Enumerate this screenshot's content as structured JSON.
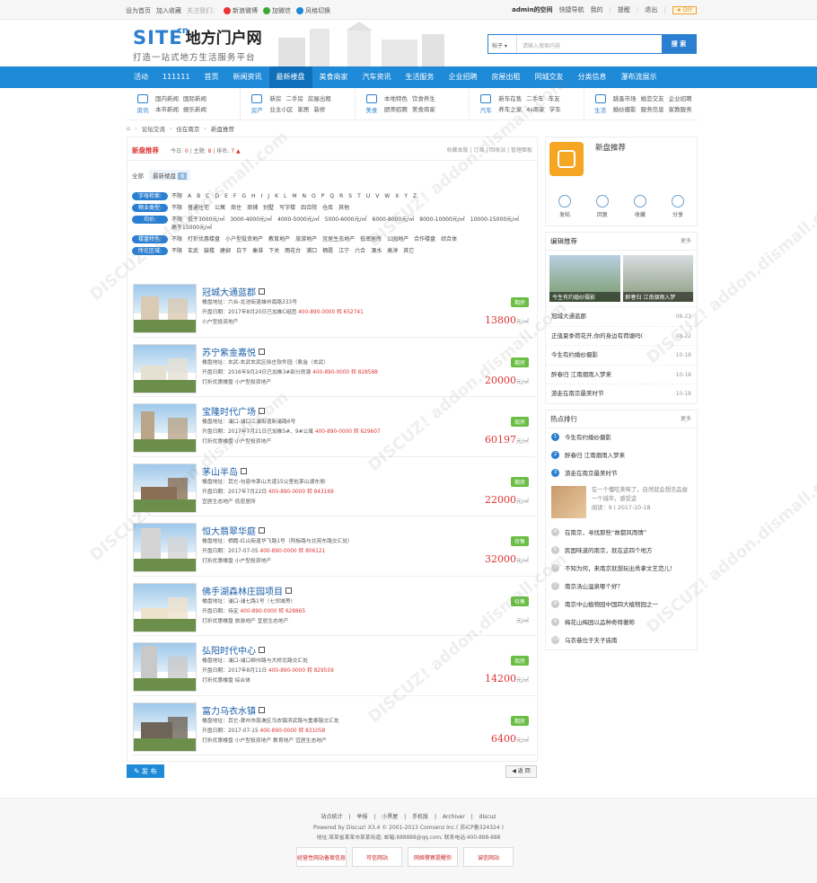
{
  "topbar": {
    "set_home": "设为首页",
    "add_fav": "加入收藏",
    "follow": "关注我们：",
    "weibo": "新浪微博",
    "wechat": "加微信",
    "style": "风格切换",
    "user": "admin的空间",
    "quicknav": "快捷导航",
    "mine": "我的",
    "remind": "提醒",
    "logout": "退出",
    "diy": "DIY"
  },
  "header": {
    "logo_site": "SITE",
    "logo_cn": "cn",
    "logo_zh": "地方门户网",
    "slogan": "打造一站式地方生活服务平台",
    "search_select": "帖子",
    "search_placeholder": "请输入搜索内容",
    "search_button": "搜 索"
  },
  "mainnav": [
    "活动",
    "111111",
    "首页",
    "新闻资讯",
    "最新楼盘",
    "美食商家",
    "汽车资讯",
    "生活服务",
    "企业招聘",
    "房屋出租",
    "同城交友",
    "分类信息",
    "瀑布流展示"
  ],
  "mainnav_active": 4,
  "subnav": [
    {
      "name": "资讯",
      "links": [
        "国内新闻",
        "国际新闻",
        "本市新闻",
        "娱乐新闻"
      ]
    },
    {
      "name": "房产",
      "links": [
        "新房",
        "二手房",
        "房屋出租",
        "业主小区",
        "家居",
        "装修"
      ]
    },
    {
      "name": "美食",
      "links": [
        "本地特色",
        "饮食养生",
        "厨师招聘",
        "美食商家"
      ]
    },
    {
      "name": "汽车",
      "links": [
        "新车在售",
        "二手车",
        "车友",
        "养车之家",
        "4s商家",
        "学车"
      ]
    },
    {
      "name": "生活",
      "links": [
        "跳蚤市场",
        "婚恋交友",
        "企业招聘",
        "婚纱摄影",
        "服务信息",
        "家教服务"
      ]
    }
  ],
  "crumb": [
    "论坛交流",
    "住在南京",
    "新盘推荐"
  ],
  "list": {
    "title": "新盘推荐",
    "today_label": "今日:",
    "today": "0",
    "topic_label": "主题:",
    "topic": "8",
    "rank_label": "排名:",
    "rank": "7",
    "ops": "收藏本版 | 订阅 | 回收站 | 管理面板",
    "tab_all": "全部",
    "tab_new": "最新楼盘",
    "tab_count": "8"
  },
  "filters": [
    {
      "label": "字母检索:",
      "opts": [
        "不限",
        "A",
        "B",
        "C",
        "D",
        "E",
        "F",
        "G",
        "H",
        "I",
        "J",
        "K",
        "L",
        "M",
        "N",
        "O",
        "P",
        "Q",
        "R",
        "S",
        "T",
        "U",
        "V",
        "W",
        "X",
        "Y",
        "Z"
      ]
    },
    {
      "label": "物业类型:",
      "opts": [
        "不限",
        "普通住宅",
        "公寓",
        "商住",
        "商铺",
        "别墅",
        "写字楼",
        "四合院",
        "仓库",
        "其他"
      ]
    },
    {
      "label": "均价:",
      "opts": [
        "不限",
        "低于3000元/㎡",
        "3000-4000元/㎡",
        "4000-5000元/㎡",
        "5000-6000元/㎡",
        "6000-8000元/㎡",
        "8000-10000元/㎡",
        "10000-15000元/㎡",
        "高于15000元/㎡"
      ]
    },
    {
      "label": "楼盘特色:",
      "opts": [
        "不限",
        "打折优惠楼盘",
        "小户型投资地产",
        "教育地产",
        "旅游地产",
        "宜居生态地产",
        "低密居所",
        "公园地产",
        "合作楼盘",
        "综合体"
      ]
    },
    {
      "label": "所在区域:",
      "opts": [
        "不限",
        "玄武",
        "鼓楼",
        "建邺",
        "白下",
        "秦淮",
        "下关",
        "雨花台",
        "浦口",
        "栖霞",
        "江宁",
        "六合",
        "溧水",
        "高淳",
        "其它"
      ]
    }
  ],
  "props": [
    {
      "name": "冠城大通蓝郡",
      "addr": "楼盘地址：六合-龙池街道雄州南路333号",
      "date": "开盘日期：2017年8月20日已加推C组团",
      "tel": "400-890-0000 转 652741",
      "tags": "小户型投资地产",
      "status": "期房",
      "price": "13800",
      "unit": "元/㎡"
    },
    {
      "name": "苏宁紫金嘉悦",
      "addr": "楼盘地址：玄武-玄武玄武区徐庄软件园（紫金（玄武）",
      "date": "开盘日期：2016年9月24日已加推3#部分房源",
      "tel": "400-890-0000 转 828588",
      "tags": "打折优惠楼盘 小户型投资地产",
      "status": "期房",
      "price": "20000",
      "unit": "元/㎡"
    },
    {
      "name": "宝隆时代广场",
      "addr": "楼盘地址：浦口-浦口江浦街道新浦路6号",
      "date": "开盘日期：2017年7月21日已加推5#、9#公寓",
      "tel": "400-890-0000 转 629607",
      "tags": "打折优惠楼盘 小户型投资地产",
      "status": "现房",
      "price": "60197",
      "unit": "元/㎡"
    },
    {
      "name": "茅山半岛",
      "addr": "楼盘地址：其它-句容市茅山大道15公里处茅山湖东侧",
      "date": "开盘日期：2017年7月22日",
      "tel": "400-890-0000 转 843169",
      "tags": "宜居生态地产 低密居所",
      "status": "期房",
      "price": "22000",
      "unit": "元/㎡"
    },
    {
      "name": "恒大翡翠华庭",
      "addr": "楼盘地址：栖霞-红山街道华飞路1号（阿板路与北苑东路交汇处）",
      "date": "开盘日期：2017-07-05",
      "tel": "400-890-0000 转 806121",
      "tags": "打折优惠楼盘 小户型投资地产",
      "status": "待售",
      "price": "32000",
      "unit": "元/㎡"
    },
    {
      "name": "佛手湖森林庄园项目",
      "addr": "楼盘地址：浦口-浦七路1号（七邻城旁）",
      "date": "开盘日期：待定",
      "tel": "400-890-0000 转 628865",
      "tags": "打折优惠楼盘 旅游地产 宜居生态地产",
      "status": "待售",
      "price": "",
      "unit": "元/㎡"
    },
    {
      "name": "弘阳时代中心",
      "addr": "楼盘地址：浦口-浦口柳州路与大桥北路交汇处",
      "date": "开盘日期：2017年8月11日",
      "tel": "400-890-0000 转 829559",
      "tags": "打折优惠楼盘 综合体",
      "status": "现房",
      "price": "14200",
      "unit": "元/㎡"
    },
    {
      "name": "富力乌衣水镇",
      "addr": "楼盘地址：其它-滁州市南谯区乌衣镇滨武路与重泰路交汇处",
      "date": "开盘日期：2017-07-15",
      "tel": "400-890-0000 转 831058",
      "tags": "打折优惠楼盘 小户型投资地产 教育地产 宜居生态地产",
      "status": "期房",
      "price": "6400",
      "unit": "元/㎡"
    }
  ],
  "post_button": "发 布",
  "back_button": "返 回",
  "right": {
    "forum_title": "新盘推荐",
    "actions": [
      "发帖",
      "回复",
      "收藏",
      "分享"
    ],
    "editor_title": "编辑推荐",
    "more": "更多",
    "pic_caps": [
      "今生有约婚纱摄影",
      "醉春归 江南烟雨入梦"
    ],
    "editor_list": [
      {
        "t": "冠城大通蓝郡",
        "d": "08-23"
      },
      {
        "t": "正值夏季荷花开,你的身边有荷塘吗(",
        "d": "08-22"
      },
      {
        "t": "今生有约婚纱摄影",
        "d": "10-18"
      },
      {
        "t": "醉春归 江南烟雨入梦来",
        "d": "10-18"
      },
      {
        "t": "游走在南京最美时节",
        "d": "10-18"
      }
    ],
    "hot_title": "热点排行",
    "hot_top": [
      "今生有约婚纱摄影",
      "醉春归 江南烟雨入梦来",
      "游走在南京最美时节"
    ],
    "feat_text": "在一个懂吃美味了，自然就会想去品尝一个城市，感受这",
    "feat_meta": "阅读：9 | 2017-10-18",
    "hot_rest": [
      "在南京，寻找那些“故都风雨情”",
      "民国味道的南京，就在这四个地方",
      "不知为何，来南京就想玩出秀拿文艺范儿！",
      "南京汤山温泉哪个好？",
      "南京中山植物园中国四大植物园之一",
      "梅花山梅园以品种奇特著称",
      "乌衣巷位于夫子庙南"
    ]
  },
  "footer": {
    "links": [
      "站点统计",
      "举报",
      "小黑屋",
      "手机版",
      "Archiver",
      "discuz"
    ],
    "powered": "Powered by Discuz! X3.4 © 2001-2013 Comsenz Inc.( 苏ICP备324324 )",
    "addr": "地址:某某省某某市某某街道; 邮箱:888888@qq.com; 联系电话:400-888-888",
    "badges": [
      "经营性网站备案信息",
      "可信网站",
      "网络警察提醒你",
      "诚信网站"
    ]
  },
  "colors": {
    "brand": "#1f8ad8",
    "price": "#dd3333",
    "status": "#6abd45"
  }
}
